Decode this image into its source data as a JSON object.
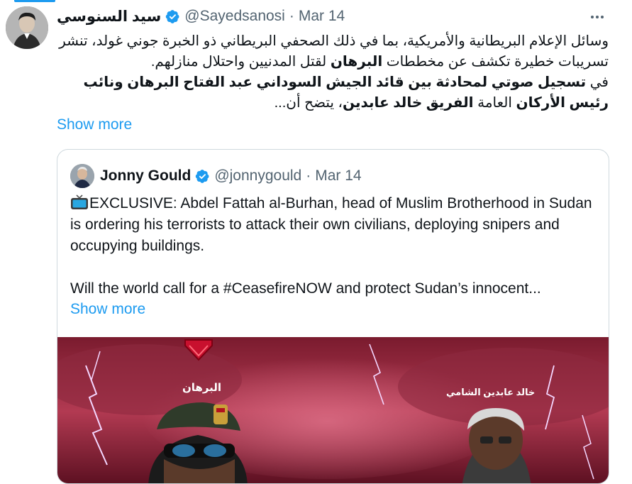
{
  "tweet": {
    "author_name": "سيد السنوسي",
    "author_handle": "@Sayedsanosi",
    "separator": "·",
    "date": "Mar 14",
    "text_1": "وسائل الإعلام البريطانية والأمريكية، بما في ذلك الصحفي البريطاني ذو الخبرة جوني غولد، تنشر تسريبات خطيرة تكشف عن مخططات ",
    "text_bold_1": "البرهان",
    "text_2": " لقتل المدنيين واحتلال منازلهم.",
    "text_3": "في ",
    "text_bold_2": "تسجيل صوتي لمحادثة بين قائد الجيش السوداني عبد الفتاح البرهان ونائب رئيس الأركان",
    "text_4": " العامة ",
    "text_bold_3": "الفريق خالد عابدين",
    "text_5": "، يتضح أن...",
    "show_more": "Show more"
  },
  "quote": {
    "author_name": "Jonny Gould",
    "author_handle": "@jonnygould",
    "separator": "·",
    "date": "Mar 14",
    "text_1": "EXCLUSIVE: Abdel Fattah al-Burhan, head of Muslim Brotherhood in Sudan is ordering his terrorists to attack their own civilians, deploying snipers and occupying buildings.",
    "text_2": "Will the world call for a #CeasefireNOW and protect Sudan’s innocent...",
    "show_more": "Show more"
  },
  "media": {
    "label_left": "البرهان",
    "label_right": "خالد عابدين الشامي"
  },
  "colors": {
    "accent": "#1d9bf0",
    "secondary_text": "#536471",
    "border": "#cfd9de"
  },
  "icons": {
    "verified": "verified-badge-icon",
    "more": "more-options-icon",
    "tv": "television-emoji-icon"
  }
}
